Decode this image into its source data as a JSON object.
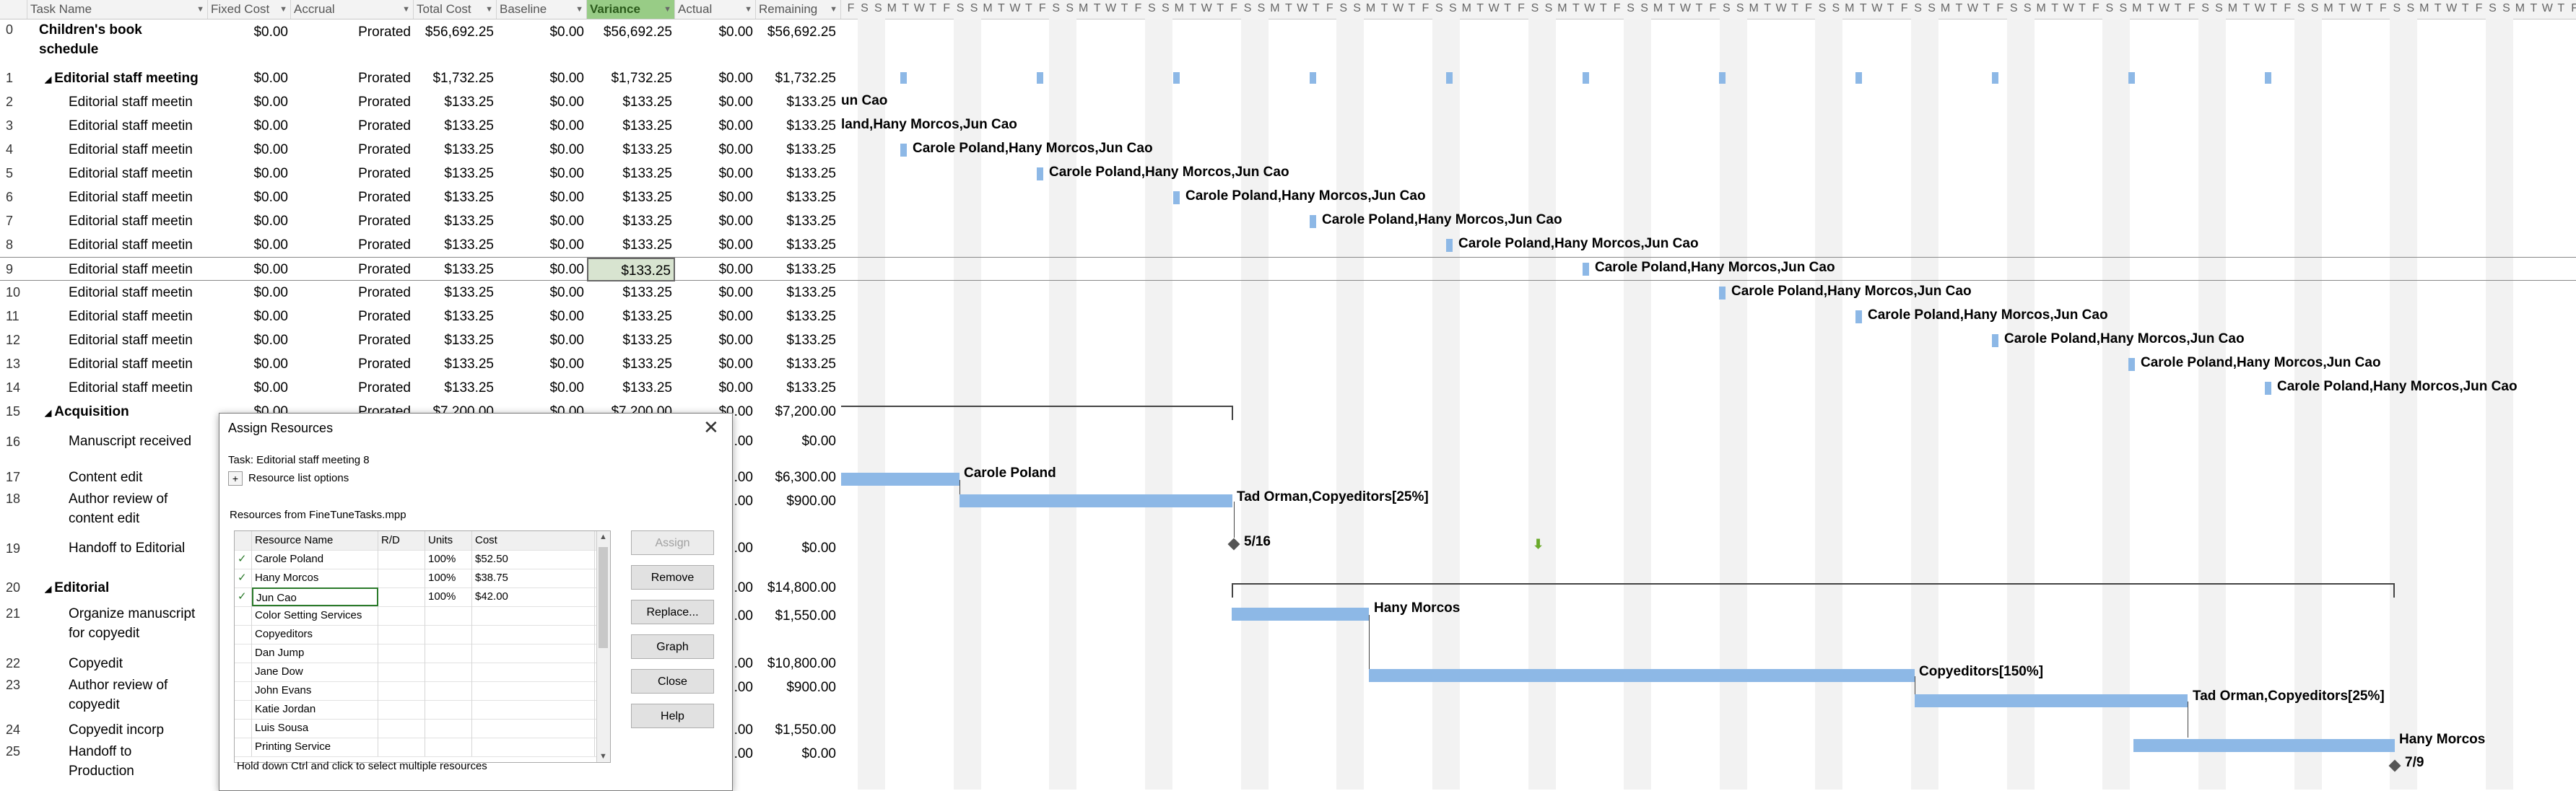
{
  "columns": [
    {
      "label": "Task Name"
    },
    {
      "label": "Fixed Cost"
    },
    {
      "label": "Accrual"
    },
    {
      "label": "Total Cost"
    },
    {
      "label": "Baseline"
    },
    {
      "label": "Variance"
    },
    {
      "label": "Actual"
    },
    {
      "label": "Remaining"
    }
  ],
  "rows": [
    {
      "id": "0",
      "name": "Children's book",
      "name2": "schedule",
      "summary": true,
      "fixed": "$0.00",
      "accrual": "Prorated",
      "total": "$56,692.25",
      "baseline": "$0.00",
      "variance": "$56,692.25",
      "actual": "$0.00",
      "remaining": "$56,692.25"
    },
    {
      "id": "1",
      "name": "Editorial staff meeting",
      "summary": true,
      "fixed": "$0.00",
      "accrual": "Prorated",
      "total": "$1,732.25",
      "baseline": "$0.00",
      "variance": "$1,732.25",
      "actual": "$0.00",
      "remaining": "$1,732.25"
    },
    {
      "id": "2",
      "name": "Editorial staff meetin",
      "fixed": "$0.00",
      "accrual": "Prorated",
      "total": "$133.25",
      "baseline": "$0.00",
      "variance": "$133.25",
      "actual": "$0.00",
      "remaining": "$133.25"
    },
    {
      "id": "3",
      "name": "Editorial staff meetin",
      "fixed": "$0.00",
      "accrual": "Prorated",
      "total": "$133.25",
      "baseline": "$0.00",
      "variance": "$133.25",
      "actual": "$0.00",
      "remaining": "$133.25"
    },
    {
      "id": "4",
      "name": "Editorial staff meetin",
      "fixed": "$0.00",
      "accrual": "Prorated",
      "total": "$133.25",
      "baseline": "$0.00",
      "variance": "$133.25",
      "actual": "$0.00",
      "remaining": "$133.25"
    },
    {
      "id": "5",
      "name": "Editorial staff meetin",
      "fixed": "$0.00",
      "accrual": "Prorated",
      "total": "$133.25",
      "baseline": "$0.00",
      "variance": "$133.25",
      "actual": "$0.00",
      "remaining": "$133.25"
    },
    {
      "id": "6",
      "name": "Editorial staff meetin",
      "fixed": "$0.00",
      "accrual": "Prorated",
      "total": "$133.25",
      "baseline": "$0.00",
      "variance": "$133.25",
      "actual": "$0.00",
      "remaining": "$133.25"
    },
    {
      "id": "7",
      "name": "Editorial staff meetin",
      "fixed": "$0.00",
      "accrual": "Prorated",
      "total": "$133.25",
      "baseline": "$0.00",
      "variance": "$133.25",
      "actual": "$0.00",
      "remaining": "$133.25"
    },
    {
      "id": "8",
      "name": "Editorial staff meetin",
      "fixed": "$0.00",
      "accrual": "Prorated",
      "total": "$133.25",
      "baseline": "$0.00",
      "variance": "$133.25",
      "actual": "$0.00",
      "remaining": "$133.25"
    },
    {
      "id": "9",
      "name": "Editorial staff meetin",
      "fixed": "$0.00",
      "accrual": "Prorated",
      "total": "$133.25",
      "baseline": "$0.00",
      "variance": "$133.25",
      "actual": "$0.00",
      "remaining": "$133.25",
      "selected": true
    },
    {
      "id": "10",
      "name": "Editorial staff meetin",
      "fixed": "$0.00",
      "accrual": "Prorated",
      "total": "$133.25",
      "baseline": "$0.00",
      "variance": "$133.25",
      "actual": "$0.00",
      "remaining": "$133.25"
    },
    {
      "id": "11",
      "name": "Editorial staff meetin",
      "fixed": "$0.00",
      "accrual": "Prorated",
      "total": "$133.25",
      "baseline": "$0.00",
      "variance": "$133.25",
      "actual": "$0.00",
      "remaining": "$133.25"
    },
    {
      "id": "12",
      "name": "Editorial staff meetin",
      "fixed": "$0.00",
      "accrual": "Prorated",
      "total": "$133.25",
      "baseline": "$0.00",
      "variance": "$133.25",
      "actual": "$0.00",
      "remaining": "$133.25"
    },
    {
      "id": "13",
      "name": "Editorial staff meetin",
      "fixed": "$0.00",
      "accrual": "Prorated",
      "total": "$133.25",
      "baseline": "$0.00",
      "variance": "$133.25",
      "actual": "$0.00",
      "remaining": "$133.25"
    },
    {
      "id": "14",
      "name": "Editorial staff meetin",
      "fixed": "$0.00",
      "accrual": "Prorated",
      "total": "$133.25",
      "baseline": "$0.00",
      "variance": "$133.25",
      "actual": "$0.00",
      "remaining": "$133.25"
    },
    {
      "id": "15",
      "name": "Acquisition",
      "summary": true,
      "fixed": "$0.00",
      "accrual": "Prorated",
      "total": "$7,200.00",
      "baseline": "$0.00",
      "variance": "$7,200.00",
      "actual": "$0.00",
      "remaining": "$7,200.00"
    },
    {
      "id": "16",
      "name": "Manuscript received",
      "actual": ".00",
      "remaining": "$0.00"
    },
    {
      "id": "17",
      "name": "Content edit",
      "actual": ".00",
      "remaining": "$6,300.00"
    },
    {
      "id": "18",
      "name": "Author review of",
      "name2": "content edit",
      "actual": ".00",
      "remaining": "$900.00"
    },
    {
      "id": "19",
      "name": "Handoff to Editorial",
      "actual": ".00",
      "remaining": "$0.00"
    },
    {
      "id": "20",
      "name": "Editorial",
      "summary": true,
      "actual": ".00",
      "remaining": "$14,800.00"
    },
    {
      "id": "21",
      "name": "Organize manuscript",
      "name2": "for copyedit",
      "actual": ".00",
      "remaining": "$1,550.00"
    },
    {
      "id": "22",
      "name": "Copyedit",
      "actual": ".00",
      "remaining": "$10,800.00"
    },
    {
      "id": "23",
      "name": "Author review of",
      "name2": "copyedit",
      "actual": ".00",
      "remaining": "$900.00"
    },
    {
      "id": "24",
      "name": "Copyedit incorp",
      "actual": ".00",
      "remaining": "$1,550.00"
    },
    {
      "id": "25",
      "name": "Handoff to",
      "name2": "Production",
      "actual": ".00",
      "remaining": "$0.00"
    }
  ],
  "gantt": {
    "day_letters": [
      "F",
      "S",
      "S",
      "M",
      "T",
      "W",
      "T"
    ],
    "resource_labels": {
      "r2": "un Cao",
      "r3": "land,Hany Morcos,Jun Cao",
      "r4": "Carole Poland,Hany Morcos,Jun Cao",
      "r5": "Carole Poland,Hany Morcos,Jun Cao",
      "r6": "Carole Poland,Hany Morcos,Jun Cao",
      "r7": "Carole Poland,Hany Morcos,Jun Cao",
      "r8": "Carole Poland,Hany Morcos,Jun Cao",
      "r9": "Carole Poland,Hany Morcos,Jun Cao",
      "r10": "Carole Poland,Hany Morcos,Jun Cao",
      "r11": "Carole Poland,Hany Morcos,Jun Cao",
      "r12": "Carole Poland,Hany Morcos,Jun Cao",
      "r13": "Carole Poland,Hany Morcos,Jun Cao",
      "r14": "Carole Poland,Hany Morcos,Jun Cao",
      "r17": "Carole Poland",
      "r18": "Tad Orman,Copyeditors[25%]",
      "r19": "5/16",
      "r21": "Hany Morcos",
      "r22": "Copyeditors[150%]",
      "r23": "Tad Orman,Copyeditors[25%]",
      "r24": "Hany Morcos",
      "r25": "7/9"
    },
    "bar_color": "#8db8e6"
  },
  "dialog": {
    "title": "Assign Resources",
    "task": "Task: Editorial staff meeting 8",
    "options_label": "Resource list options",
    "options_toggle": "+",
    "from": "Resources from FineTuneTasks.mpp",
    "headers": {
      "name": "Resource Name",
      "rd": "R/D",
      "units": "Units",
      "cost": "Cost"
    },
    "resources": [
      {
        "check": "✓",
        "name": "Carole Poland",
        "units": "100%",
        "cost": "$52.50"
      },
      {
        "check": "✓",
        "name": "Hany Morcos",
        "units": "100%",
        "cost": "$38.75"
      },
      {
        "check": "✓",
        "name": "Jun Cao",
        "units": "100%",
        "cost": "$42.00"
      },
      {
        "name": "Color Setting Services"
      },
      {
        "name": "Copyeditors"
      },
      {
        "name": "Dan Jump"
      },
      {
        "name": "Jane Dow"
      },
      {
        "name": "John Evans"
      },
      {
        "name": "Katie Jordan"
      },
      {
        "name": "Luis Sousa"
      },
      {
        "name": "Printing Service"
      }
    ],
    "buttons": {
      "assign": "Assign",
      "remove": "Remove",
      "replace": "Replace...",
      "graph": "Graph",
      "close": "Close",
      "help": "Help"
    },
    "hint": "Hold down Ctrl and click to select multiple resources"
  }
}
